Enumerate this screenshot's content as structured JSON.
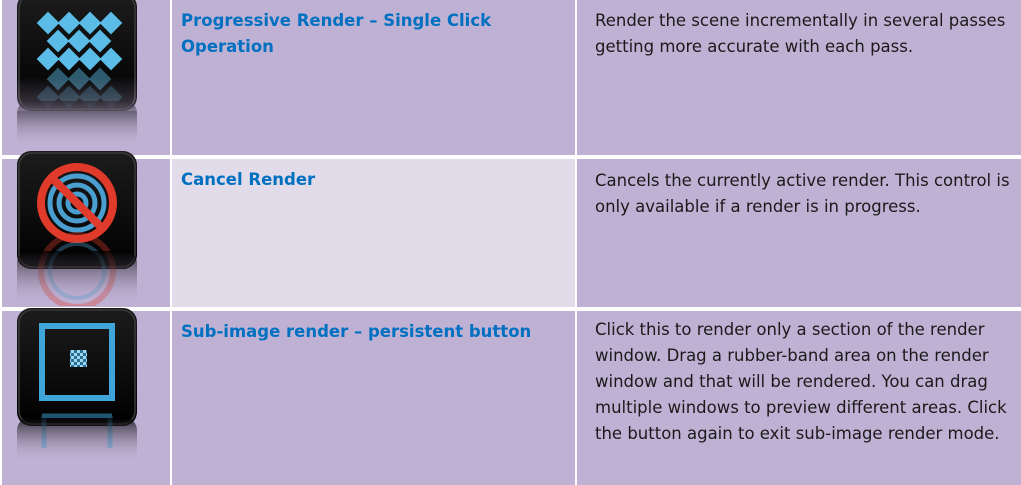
{
  "rows": [
    {
      "icon": "progressive-render-icon",
      "name": "Progressive Render – Single Click Operation",
      "description": "Render the scene incrementally in several passes getting more accurate with each pass."
    },
    {
      "icon": "cancel-render-icon",
      "name": "Cancel Render",
      "description": "Cancels the currently active render.  This control is only available if a render is in progress."
    },
    {
      "icon": "sub-image-render-icon",
      "name": "Sub-image render – persistent button",
      "description": "Click this to render only a section of the render window.  Drag a rubber-band area on the render window and that will be rendered. You can drag multiple windows to preview different areas. Click the button again to exit sub-image render mode."
    }
  ],
  "colors": {
    "cell_background": "#bfb1d4",
    "highlighted_cell_background": "#e1dbea",
    "name_text": "#0070c0",
    "description_text": "#1a1a1a",
    "icon_diamond": "#5bbce8",
    "icon_cancel_red": "#e03a2a",
    "icon_frame_blue": "#3fa4d8"
  }
}
